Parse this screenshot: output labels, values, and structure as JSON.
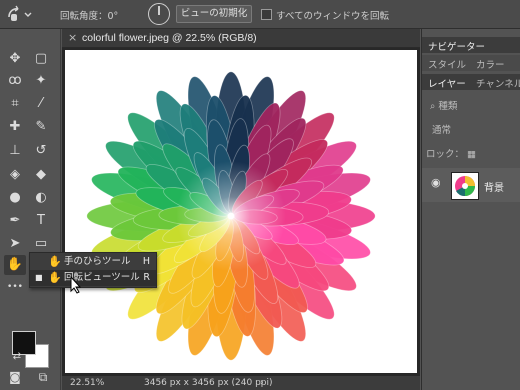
{
  "options_bar": {
    "rotation_label": "回転角度：",
    "rotation_value": "0°",
    "reset_view_button": "ビューの初期化",
    "rotate_all_label": "すべてのウィンドウを回転",
    "rotate_all_checked": false
  },
  "document": {
    "tab_title": "colorful flower.jpeg @ 22.5% (RGB/8)",
    "close_glyph": "×"
  },
  "status": {
    "zoom": "22.51%",
    "dimensions": "3456 px x 3456 px (240 ppi)",
    "arrow": "›"
  },
  "toolbar": {
    "tools": [
      {
        "name": "move-tool",
        "glyph": "✥"
      },
      {
        "name": "artboard-tool",
        "glyph": "▢"
      },
      {
        "name": "lasso-tool",
        "glyph": "ꝏ"
      },
      {
        "name": "magic-wand-tool",
        "glyph": "✦"
      },
      {
        "name": "crop-tool",
        "glyph": "⌗"
      },
      {
        "name": "eyedropper-tool",
        "glyph": "⁄"
      },
      {
        "name": "healing-tool",
        "glyph": "✚"
      },
      {
        "name": "brush-tool",
        "glyph": "✎"
      },
      {
        "name": "stamp-tool",
        "glyph": "⊥"
      },
      {
        "name": "history-brush-tool",
        "glyph": "↺"
      },
      {
        "name": "eraser-tool",
        "glyph": "◈"
      },
      {
        "name": "bucket-tool",
        "glyph": "◆"
      },
      {
        "name": "blur-tool",
        "glyph": "●"
      },
      {
        "name": "dodge-tool",
        "glyph": "◐"
      },
      {
        "name": "pen-tool",
        "glyph": "✒"
      },
      {
        "name": "type-tool",
        "glyph": "T"
      },
      {
        "name": "path-select-tool",
        "glyph": "➤"
      },
      {
        "name": "shape-tool",
        "glyph": "▭"
      },
      {
        "name": "rotate-view-tool",
        "glyph": "✋"
      },
      {
        "name": "zoom-tool",
        "glyph": "⌕"
      },
      {
        "name": "more-tools",
        "glyph": "•••"
      }
    ],
    "foreground_color": "#111111",
    "background_color": "#ffffff"
  },
  "flyout": {
    "items": [
      {
        "icon": "✋",
        "label": "手のひらツール",
        "shortcut": "H",
        "active": false
      },
      {
        "icon": "✋",
        "label": "回転ビューツール",
        "shortcut": "R",
        "active": true
      }
    ],
    "bullet": "■"
  },
  "panels": {
    "top_tab": "ナビゲーター",
    "second_tabs": [
      "スタイル",
      "カラー"
    ],
    "layer_tabs": [
      "レイヤー",
      "チャンネル"
    ],
    "filter_placeholder": "種類",
    "blend_mode": "通常",
    "lock_label": "ロック：",
    "layer_name": "背景",
    "eye_glyph": "👁",
    "menu_glyph": "≡"
  }
}
